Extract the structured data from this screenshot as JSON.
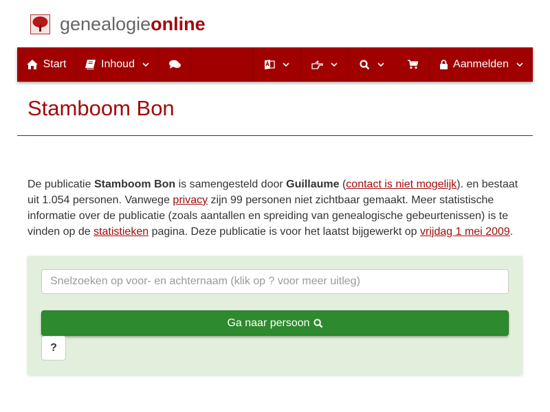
{
  "brand": {
    "pre": "genealogie",
    "post": "online"
  },
  "nav": {
    "start": "Start",
    "inhoud": "Inhoud",
    "login": "Aanmelden"
  },
  "page": {
    "title": "Stamboom Bon"
  },
  "intro": {
    "t1": "De publicatie ",
    "pub_name": "Stamboom Bon",
    "t2": " is samengesteld door ",
    "author": "Guillaume",
    "t3": " (",
    "contact_link": "contact is niet mogelijk",
    "t4": "). en bestaat uit 1.054 personen. Vanwege ",
    "privacy_link": "privacy",
    "t5": " zijn 99 personen niet zichtbaar gemaakt. Meer statistische informatie over de publicatie (zoals aantallen en spreiding van genealogische gebeurtenissen) is te vinden op de ",
    "stats_link": "statistieken",
    "t6": " pagina. Deze publicatie is voor het laatst bijgewerkt op ",
    "date_link": "vrijdag 1 mei 2009",
    "t7": "."
  },
  "search": {
    "placeholder": "Snelzoeken op voor- en achternaam (klik op ? voor meer uitleg)",
    "button_label": "Ga naar persoon",
    "help_label": "?"
  },
  "colors": {
    "brand_red": "#a00000",
    "panel_green": "#e1efdc",
    "button_green": "#2e8a2e"
  }
}
